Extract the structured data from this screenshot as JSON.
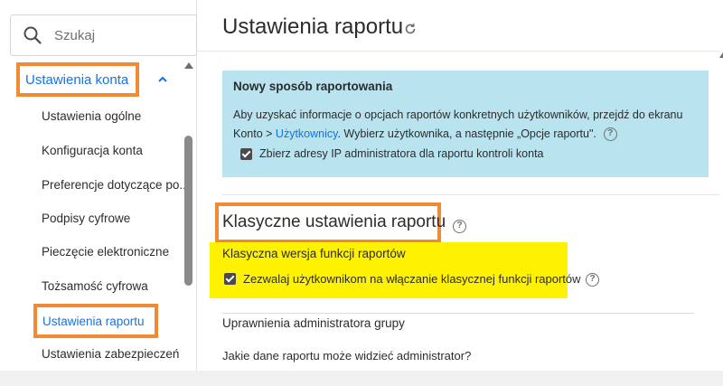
{
  "search": {
    "placeholder": "Szukaj"
  },
  "sidebar": {
    "section_label": "Ustawienia konta",
    "items": [
      {
        "label": "Ustawienia ogólne"
      },
      {
        "label": "Konfiguracja konta"
      },
      {
        "label": "Preferencje dotyczące po..."
      },
      {
        "label": "Podpisy cyfrowe"
      },
      {
        "label": "Pieczęcie elektroniczne"
      },
      {
        "label": "Tożsamość cyfrowa"
      },
      {
        "label": "Ustawienia raportu"
      },
      {
        "label": "Ustawienia zabezpieczeń"
      }
    ],
    "active_index": 6
  },
  "main": {
    "title": "Ustawienia raportu",
    "info": {
      "title": "Nowy sposób raportowania",
      "text_before": "Aby uzyskać informacje o opcjach raportów konkretnych użytkowników, przejdź do ekranu Konto > ",
      "link": "Użytkownicy",
      "text_after": ". Wybierz użytkownika, a następnie „Opcje raportu\".",
      "checkbox_label": "Zbierz adresy IP administratora dla raportu kontroli konta",
      "checkbox_checked": true
    },
    "classic": {
      "title": "Klasyczne ustawienia raportu",
      "subtitle": "Klasyczna wersja funkcji raportów",
      "checkbox_label": "Zezwalaj użytkownikom na włączanie klasycznej funkcji raportów",
      "checkbox_checked": true
    },
    "group": {
      "title": "Uprawnienia administratora grupy",
      "question": "Jakie dane raportu może widzieć administrator?"
    }
  },
  "colors": {
    "accent": "#1473e6",
    "highlight_border": "#f08a35",
    "info_bg": "#b9e3ee",
    "yellow": "#fff200"
  }
}
